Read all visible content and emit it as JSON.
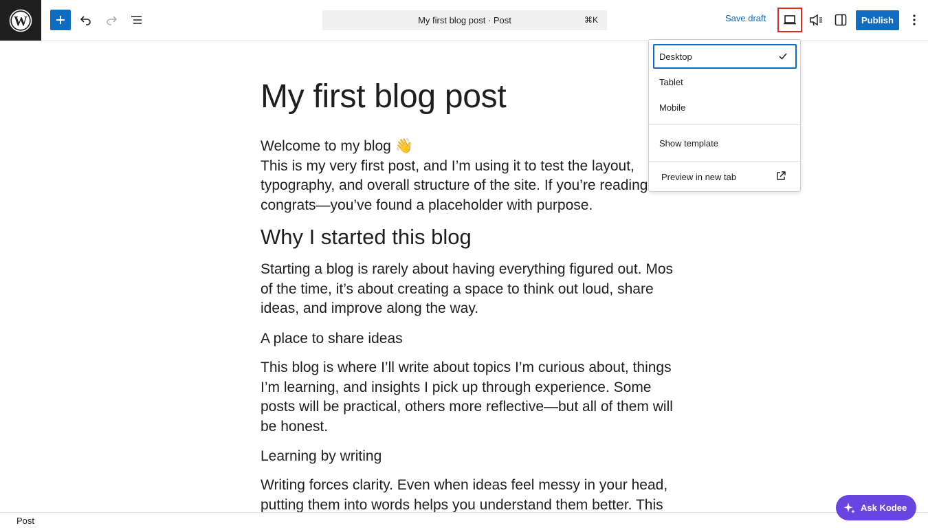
{
  "toolbar": {
    "document_title": "My first blog post · Post",
    "shortcut": "⌘K",
    "save_draft_label": "Save draft",
    "publish_label": "Publish"
  },
  "post": {
    "title": "My first blog post",
    "welcome": "Welcome to my blog 👋",
    "intro_lines": [
      "This is my very first post, and I’m using it to test the layout,",
      "typography, and overall structure of the site. If you’re reading this,",
      "congrats—you’ve found a placeholder with purpose."
    ],
    "h2_1": "Why I started this blog",
    "p2_lines": [
      "Starting a blog is rarely about having everything figured out. Most",
      "of the time, it’s about creating a space to think out loud, share",
      "ideas, and improve along the way."
    ],
    "h3_1": "A place to share ideas",
    "p3_lines": [
      "This blog is where I’ll write about topics I’m curious about, things",
      "I’m learning, and insights I pick up through experience. Some",
      "posts will be practical, others more reflective—but all of them will",
      "be honest."
    ],
    "h3_2": "Learning by writing",
    "p4_lines": [
      "Writing forces clarity. Even when ideas feel messy in your head,",
      "putting them into words helps you understand them better. This"
    ]
  },
  "preview_menu": {
    "items": [
      "Desktop",
      "Tablet",
      "Mobile"
    ],
    "selected": "Desktop",
    "show_template": "Show template",
    "preview_new_tab": "Preview in new tab"
  },
  "status_bar": {
    "label": "Post"
  },
  "assistant": {
    "label": "Ask Kodee"
  },
  "colors": {
    "accent": "#0f6cc1",
    "highlight_box": "#e0271f",
    "assistant": "#6a44e0"
  }
}
